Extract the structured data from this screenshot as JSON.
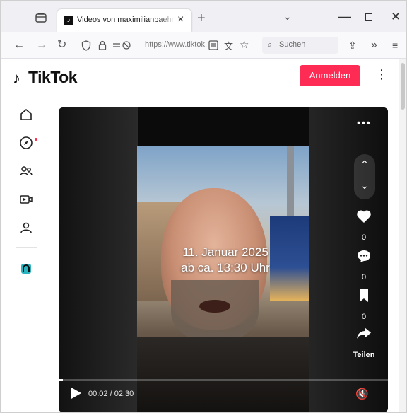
{
  "browser": {
    "tab_title": "Videos von maximilianbaehring",
    "tab_favicon": "tiktok-icon",
    "url": "https://www.tiktok.com",
    "search_placeholder": "Suchen",
    "accent": "#f0f0f4"
  },
  "tiktok": {
    "logo_text": "TikTok",
    "login_label": "Anmelden",
    "brand_color": "#fe2c55",
    "sidenav_icons": [
      "home-icon",
      "explore-icon",
      "following-icon",
      "live-icon",
      "profile-icon",
      "app-icon"
    ]
  },
  "video": {
    "overlay_line1": "11. Januar 2025",
    "overlay_line2": "ab ca. 13:30 Uhr",
    "likes": "0",
    "comments": "0",
    "saves": "0",
    "share_label": "Teilen",
    "time": "00:02 / 02:30",
    "progress": 0.013
  }
}
